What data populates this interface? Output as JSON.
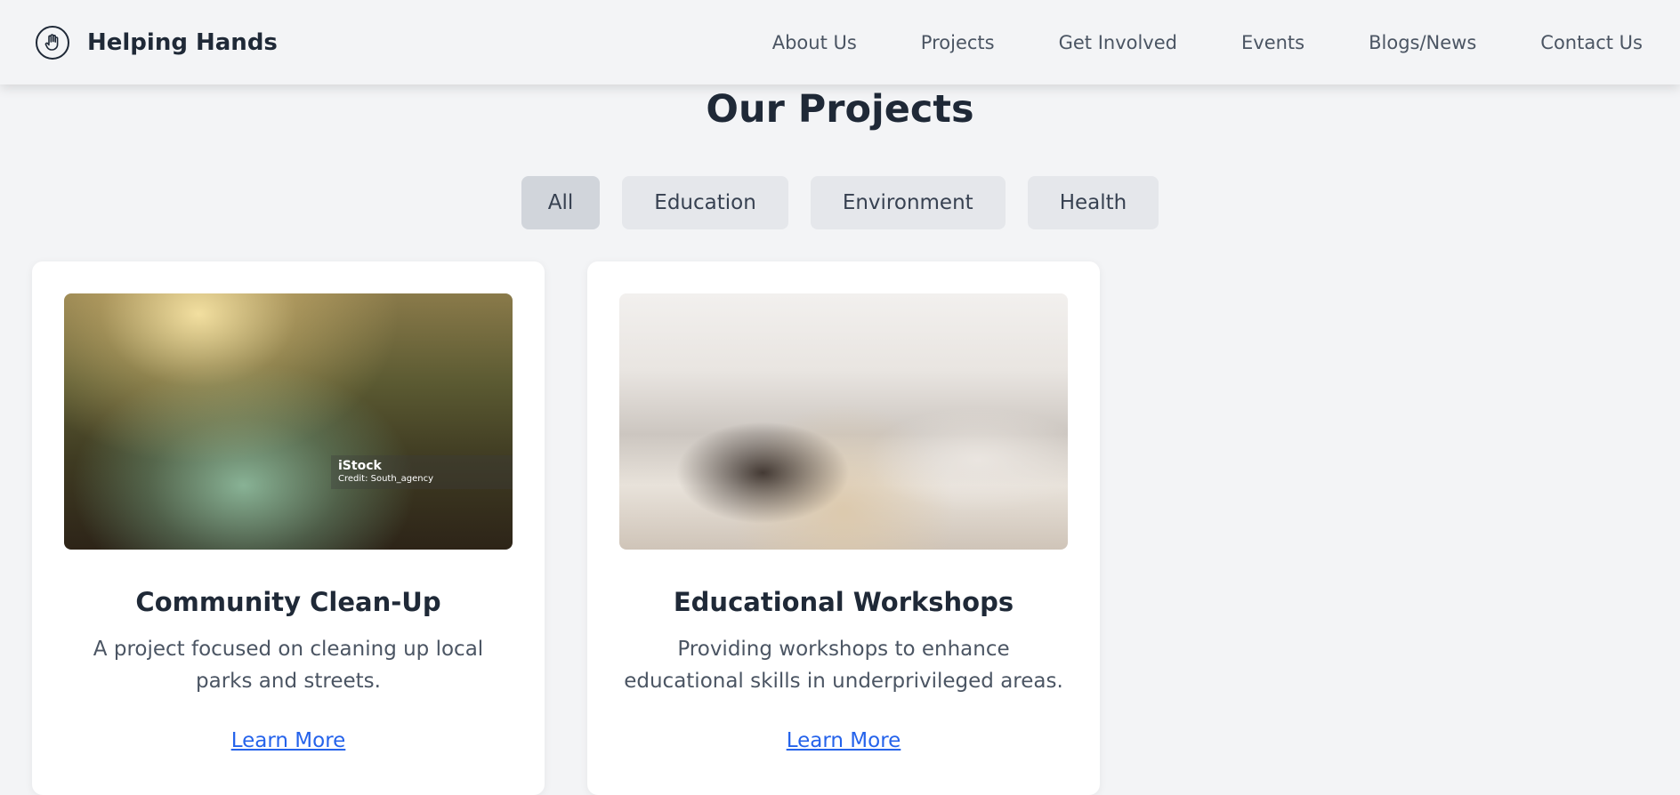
{
  "brand": {
    "name": "Helping Hands",
    "icon": "hand-icon"
  },
  "nav": {
    "links": [
      {
        "label": "About Us"
      },
      {
        "label": "Projects"
      },
      {
        "label": "Get Involved"
      },
      {
        "label": "Events"
      },
      {
        "label": "Blogs/News"
      },
      {
        "label": "Contact Us"
      }
    ]
  },
  "page": {
    "title": "Our Projects"
  },
  "filters": {
    "options": [
      {
        "label": "All",
        "active": true
      },
      {
        "label": "Education",
        "active": false
      },
      {
        "label": "Environment",
        "active": false
      },
      {
        "label": "Health",
        "active": false
      }
    ]
  },
  "projects": [
    {
      "title": "Community Clean-Up",
      "description": "A project focused on cleaning up local parks and streets.",
      "link_label": "Learn More",
      "image_watermark": {
        "brand": "iStock",
        "credit": "Credit: South_agency"
      }
    },
    {
      "title": "Educational Workshops",
      "description": "Providing workshops to enhance educational skills in underprivileged areas.",
      "link_label": "Learn More"
    }
  ],
  "colors": {
    "background": "#f3f4f6",
    "card": "#ffffff",
    "link": "#2563eb",
    "filter_active": "#d1d5db",
    "filter": "#e5e7eb"
  }
}
